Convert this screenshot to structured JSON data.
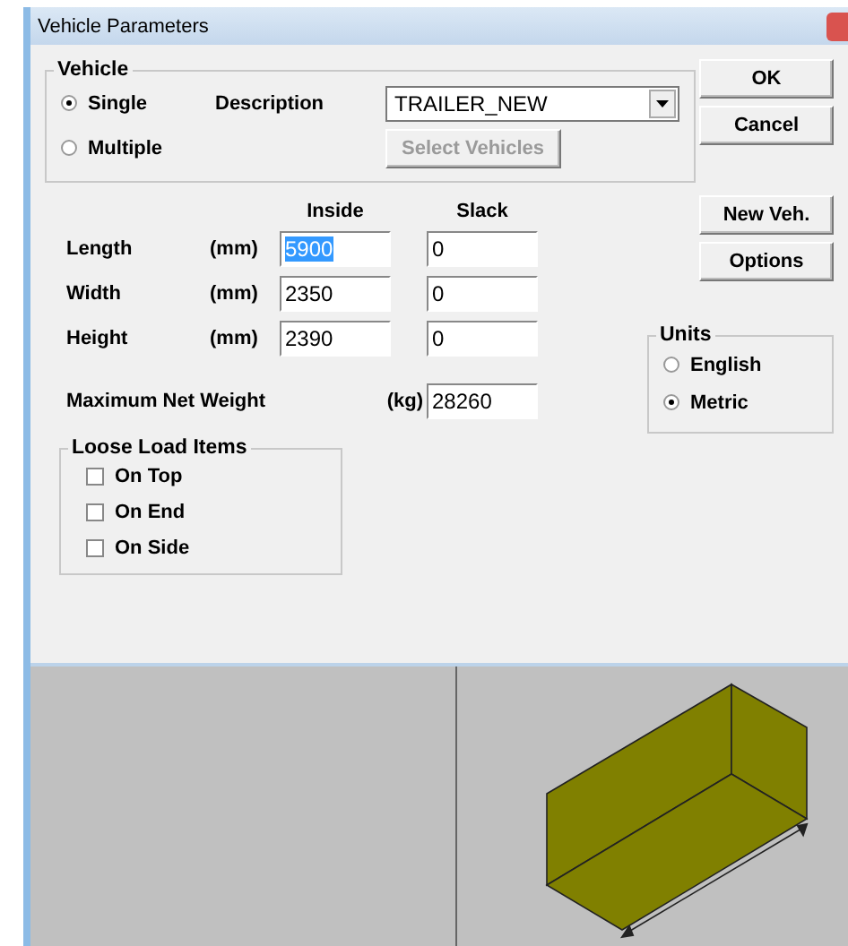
{
  "window": {
    "title": "Vehicle Parameters"
  },
  "vehicle": {
    "title": "Vehicle",
    "modes": [
      {
        "label": "Single",
        "selected": true
      },
      {
        "label": "Multiple",
        "selected": false
      }
    ],
    "description_label": "Description",
    "description_value": "TRAILER_NEW",
    "select_button": {
      "label": "Select Vehicles",
      "disabled": true
    }
  },
  "buttons": [
    {
      "label": "OK"
    },
    {
      "label": "Cancel"
    },
    {
      "label": "New Veh."
    },
    {
      "label": "Options"
    }
  ],
  "dimensions": {
    "headers": [
      "Inside",
      "Slack"
    ],
    "rows": [
      {
        "label": "Length",
        "unit": "(mm)",
        "inside": "5900",
        "inside_highlighted": true,
        "slack": "0"
      },
      {
        "label": "Width",
        "unit": "(mm)",
        "inside": "2350",
        "inside_highlighted": false,
        "slack": "0"
      },
      {
        "label": "Height",
        "unit": "(mm)",
        "inside": "2390",
        "inside_highlighted": false,
        "slack": "0"
      }
    ]
  },
  "weight": {
    "label": "Maximum Net Weight",
    "unit": "(kg)",
    "value": "28260"
  },
  "loose_load": {
    "title": "Loose Load Items",
    "items": [
      {
        "label": "On Top",
        "checked": false
      },
      {
        "label": "On End",
        "checked": false
      },
      {
        "label": "On Side",
        "checked": false
      }
    ]
  },
  "units": {
    "title": "Units",
    "options": [
      {
        "label": "English",
        "selected": false
      },
      {
        "label": "Metric",
        "selected": true
      }
    ]
  }
}
